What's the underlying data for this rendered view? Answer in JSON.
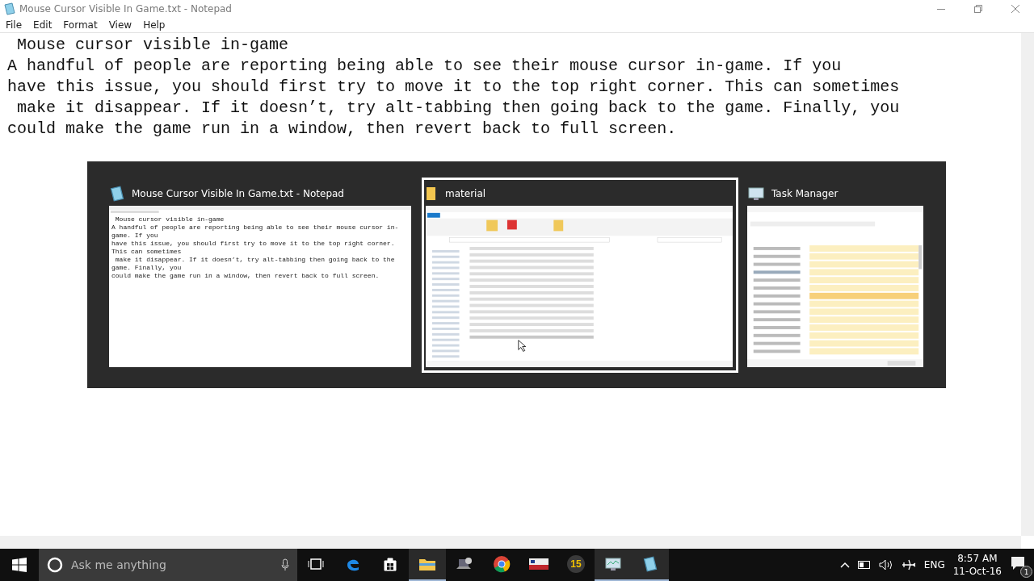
{
  "window": {
    "title": "Mouse Cursor Visible In Game.txt - Notepad"
  },
  "menu": [
    "File",
    "Edit",
    "Format",
    "View",
    "Help"
  ],
  "document": {
    "lines": [
      " Mouse cursor visible in-game",
      "A handful of people are reporting being able to see their mouse cursor in-game. If you",
      "have this issue, you should first try to move it to the top right corner. This can sometimes",
      " make it disappear. If it doesn’t, try alt-tabbing then going back to the game. Finally, you",
      "could make the game run in a window, then revert back to full screen."
    ]
  },
  "switcher": [
    {
      "title": "Mouse Cursor Visible In Game.txt - Notepad",
      "kind": "notepad",
      "selected": false,
      "lines": [
        " Mouse cursor visible in-game",
        "A handful of people are reporting being able to see their mouse cursor in-game. If you",
        "have this issue, you should first try to move it to the top right corner. This can sometimes",
        " make it disappear. If it doesn’t, try alt-tabbing then going back to the game. Finally, you",
        "could make the game run in a window, then revert back to full screen."
      ]
    },
    {
      "title": "material",
      "kind": "explorer",
      "selected": true
    },
    {
      "title": "Task Manager",
      "kind": "taskmanager",
      "selected": false
    }
  ],
  "taskbar": {
    "search": {
      "placeholder": "Ask me anything"
    },
    "apps": [
      {
        "kind": "edge",
        "active": false
      },
      {
        "kind": "store",
        "active": false
      },
      {
        "kind": "folder",
        "active": true
      },
      {
        "kind": "laptop",
        "active": false
      },
      {
        "kind": "chrome",
        "active": false
      },
      {
        "kind": "game",
        "active": false
      },
      {
        "kind": "badge",
        "label": "15",
        "active": false
      },
      {
        "kind": "monitor",
        "active": true
      },
      {
        "kind": "notepad",
        "active": true
      }
    ],
    "language": "ENG",
    "time": "8:57 AM",
    "date": "11-Oct-16",
    "notifications": "1"
  }
}
